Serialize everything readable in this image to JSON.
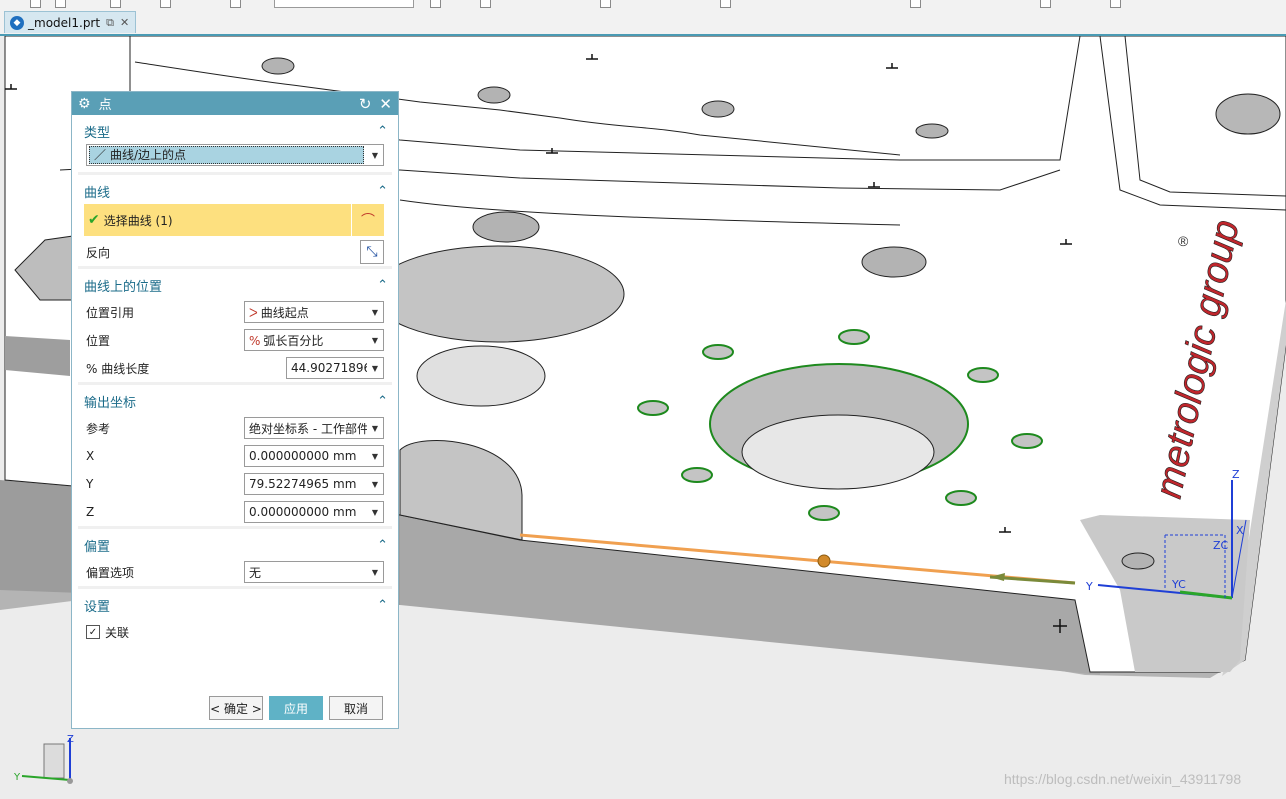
{
  "tab": {
    "file_name": "_model1.prt",
    "close_symbol": "✕"
  },
  "dialog": {
    "title": "点",
    "type_section": {
      "header": "类型",
      "selected": "曲线/边上的点"
    },
    "curve_section": {
      "header": "曲线",
      "select_label": "选择曲线 (1)",
      "reverse_label": "反向"
    },
    "position_section": {
      "header": "曲线上的位置",
      "rows": [
        {
          "label": "位置引用",
          "value": "曲线起点"
        },
        {
          "label": "位置",
          "value": "弧长百分比"
        },
        {
          "label": "% 曲线长度",
          "value": "44.90271896"
        }
      ]
    },
    "output_section": {
      "header": "输出坐标",
      "reference_label": "参考",
      "reference_value": "绝对坐标系 - 工作部件",
      "coords": [
        {
          "label": "X",
          "value": "0.000000000",
          "unit": "mm"
        },
        {
          "label": "Y",
          "value": "79.52274965",
          "unit": "mm"
        },
        {
          "label": "Z",
          "value": "0.000000000",
          "unit": "mm"
        }
      ]
    },
    "offset_section": {
      "header": "偏置",
      "label": "偏置选项",
      "value": "无"
    },
    "settings_section": {
      "header": "设置",
      "associative_label": "关联",
      "associative_checked": true
    },
    "buttons": {
      "ok": "< 确定 >",
      "apply": "应用",
      "cancel": "取消"
    }
  },
  "viewport": {
    "logo_text": "metrologic group",
    "registered_mark": "®",
    "triad_labels": {
      "z": "Z",
      "y": "Y",
      "x": "X",
      "yc": "YC",
      "zc": "ZC"
    }
  },
  "watermark": "https://blog.csdn.net/weixin_43911798",
  "colors": {
    "accent": "#5a9fb6",
    "selection": "#fde07f",
    "edge_highlight": "#f0a050",
    "hole_highlight": "#1e8a1e"
  }
}
